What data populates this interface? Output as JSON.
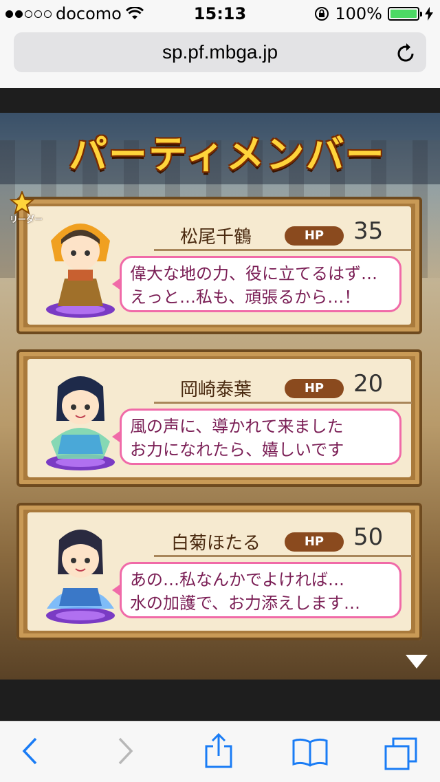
{
  "statusbar": {
    "carrier": "docomo",
    "time": "15:13",
    "battery": "100%"
  },
  "browser": {
    "url": "sp.pf.mbga.jp"
  },
  "game": {
    "title": "パーティメンバー",
    "leader_label": "リーダー",
    "hp_label": "HP",
    "members": [
      {
        "name": "松尾千鶴",
        "hp": "35",
        "line1": "偉大な地の力、役に立てるはず…",
        "line2": "えっと…私も、頑張るから…！",
        "element": "earth"
      },
      {
        "name": "岡崎泰葉",
        "hp": "20",
        "line1": "風の声に、導かれて来ました",
        "line2": "お力になれたら、嬉しいです",
        "element": "wind"
      },
      {
        "name": "白菊ほたる",
        "hp": "50",
        "line1": "あの…私なんかでよければ…",
        "line2": "水の加護で、お力添えします…",
        "element": "water"
      }
    ]
  },
  "colors": {
    "bubble_border": "#f06aa8",
    "title": "#ffd43b",
    "hp_badge": "#8a4a1e",
    "ios_blue": "#1a7cf5"
  }
}
